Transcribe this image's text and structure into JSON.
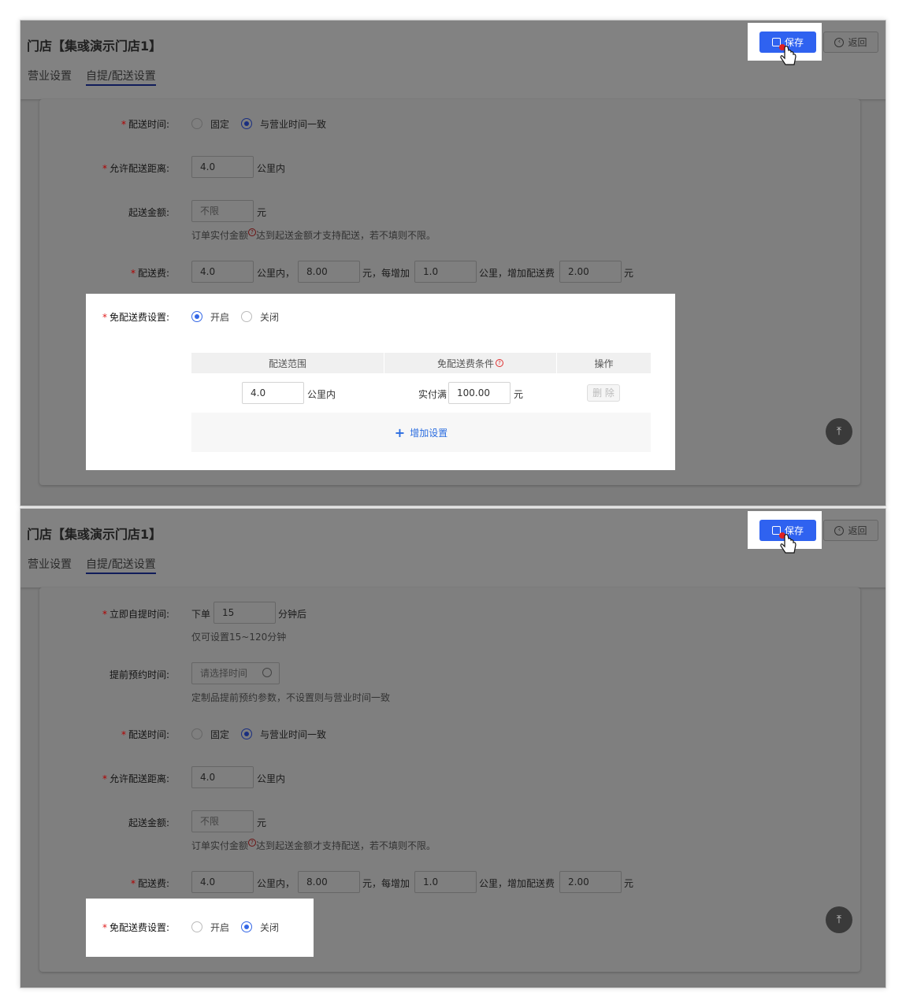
{
  "header": {
    "title": "门店【集彧演示门店1】",
    "tabs": [
      "营业设置",
      "自提/配送设置"
    ],
    "save_label": "保存",
    "back_label": "返回"
  },
  "form": {
    "pickup_time_label": "立即自提时间:",
    "pickup_prefix": "下单",
    "pickup_value": "15",
    "pickup_suffix": "分钟后",
    "pickup_hint": "仅可设置15~120分钟",
    "reserve_label": "提前预约时间:",
    "reserve_placeholder": "请选择时间",
    "reserve_hint": "定制品提前预约参数，不设置则与营业时间一致",
    "delivery_time_label": "配送时间:",
    "delivery_time_options": [
      "固定",
      "与营业时间一致"
    ],
    "distance_label": "允许配送距离:",
    "distance_value": "4.0",
    "distance_unit": "公里内",
    "min_amount_label": "起送金额:",
    "min_amount_placeholder": "不限",
    "min_amount_unit": "元",
    "min_amount_hint_a": "订单实付金额",
    "min_amount_hint_b": "达到起送金额才支持配送，若不填则不限。",
    "fee_label": "配送费:",
    "fee_km": "4.0",
    "fee_text1": "公里内，",
    "fee_base": "8.00",
    "fee_text2": "元，每增加",
    "fee_step": "1.0",
    "fee_text3": "公里，增加配送费",
    "fee_add": "2.00",
    "fee_text4": "元",
    "free_fee_label": "免配送费设置:",
    "free_fee_options": [
      "开启",
      "关闭"
    ]
  },
  "free_table": {
    "headers": [
      "配送范围",
      "免配送费条件",
      "操作"
    ],
    "row": {
      "range": "4.0",
      "range_unit": "公里内",
      "cond_prefix": "实付满",
      "cond_value": "100.00",
      "cond_unit": "元",
      "delete_label": "删 除"
    },
    "add_label": "增加设置"
  },
  "state": {
    "panel1_free_fee": "开启",
    "panel2_free_fee": "关闭",
    "delivery_time_selected": "与营业时间一致"
  },
  "icons": [
    "save-icon",
    "back-icon",
    "hand-cursor-icon",
    "question-icon",
    "plus-icon",
    "back-to-top-icon"
  ]
}
